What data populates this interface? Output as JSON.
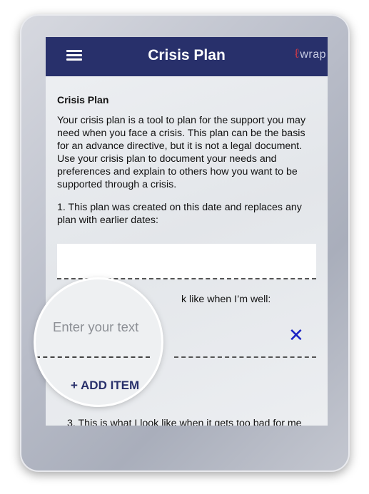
{
  "appbar": {
    "title": "Crisis Plan",
    "brand": "wrap",
    "menu_icon": "hamburger-menu-icon"
  },
  "content": {
    "section_title": "Crisis Plan",
    "intro": "Your crisis plan is a tool to plan for the support you may need when you face a crisis. This plan can be the basis for an advance directive, but it is not a legal document. Use your crisis plan to document your needs and preferences and explain to others how you want to be supported through a crisis.",
    "question1": "1. This plan was created on this date and replaces any plan with earlier dates:",
    "date_value": "",
    "question2_visible": "k like when I’m well:",
    "question3": "3. This is what I look like when it gets too bad for me"
  },
  "item_entry": {
    "placeholder": "Enter your text",
    "remove_icon": "close-x-icon",
    "add_label": "+ ADD ITEM"
  },
  "colors": {
    "appbar": "#28306b",
    "accent_blue": "#1b23c4"
  }
}
